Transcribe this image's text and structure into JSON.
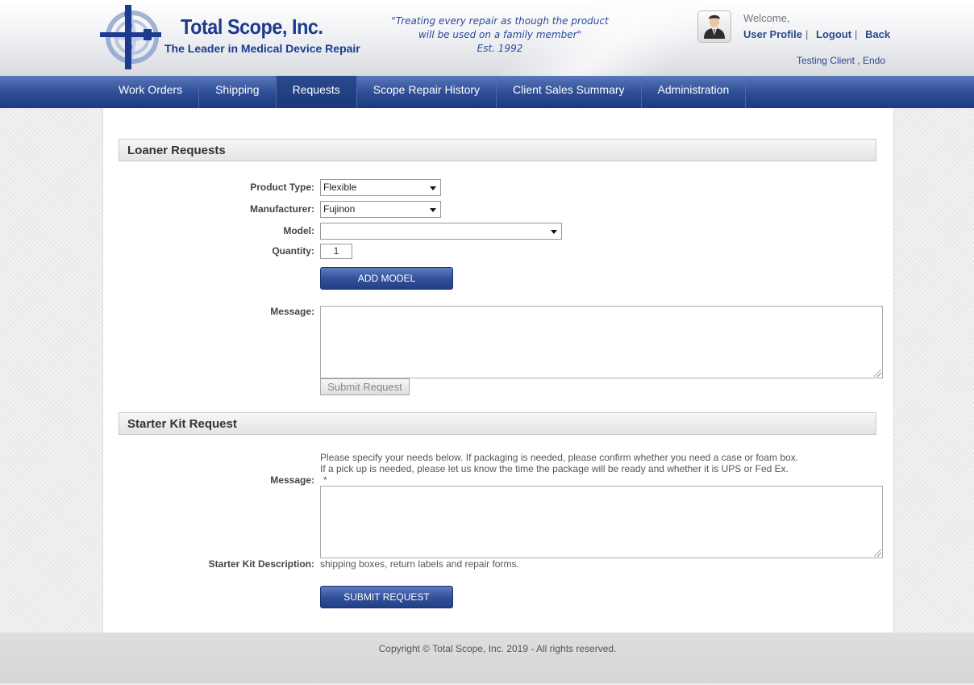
{
  "header": {
    "company_name": "Total Scope, Inc.",
    "tagline": "The Leader in Medical Device Repair",
    "motto_line1": "\"Treating every repair as though the product",
    "motto_line2": "will be used on a family member\"",
    "motto_line3": "Est. 1992",
    "welcome": "Welcome,",
    "user_profile": "User Profile",
    "logout": "Logout",
    "back": "Back",
    "separator": "|",
    "client_name": "Testing Client , Endo"
  },
  "nav": {
    "tabs": [
      {
        "label": "Work Orders"
      },
      {
        "label": "Shipping"
      },
      {
        "label": "Requests"
      },
      {
        "label": "Scope Repair History"
      },
      {
        "label": "Client Sales Summary"
      },
      {
        "label": "Administration"
      }
    ],
    "active": "Requests"
  },
  "loaner": {
    "title": "Loaner Requests",
    "product_type_label": "Product Type:",
    "product_type_value": "Flexible",
    "manufacturer_label": "Manufacturer:",
    "manufacturer_value": "Fujinon",
    "model_label": "Model:",
    "model_value": "",
    "quantity_label": "Quantity:",
    "quantity_value": "1",
    "add_model_button": "ADD MODEL",
    "message_label": "Message:",
    "submit_button": "Submit Request"
  },
  "starter": {
    "title": "Starter Kit Request",
    "note_line1": "Please specify your needs below. If packaging is needed, please confirm whether you need a case or foam box.",
    "note_line2": "If a pick up is needed, please let us know the time the package will be ready and whether it is UPS or Fed Ex.",
    "required_mark": "*",
    "message_label": "Message:",
    "description_label": "Starter Kit Description:",
    "description_value": "shipping boxes, return labels and repair forms.",
    "submit_button": "SUBMIT REQUEST"
  },
  "footer": {
    "copyright": "Copyright © Total Scope, Inc. 2019 - All rights reserved."
  },
  "colors": {
    "brand_blue": "#1b3b8f",
    "nav_blue": "#2f4f97",
    "link_blue": "#2a4a8a"
  }
}
